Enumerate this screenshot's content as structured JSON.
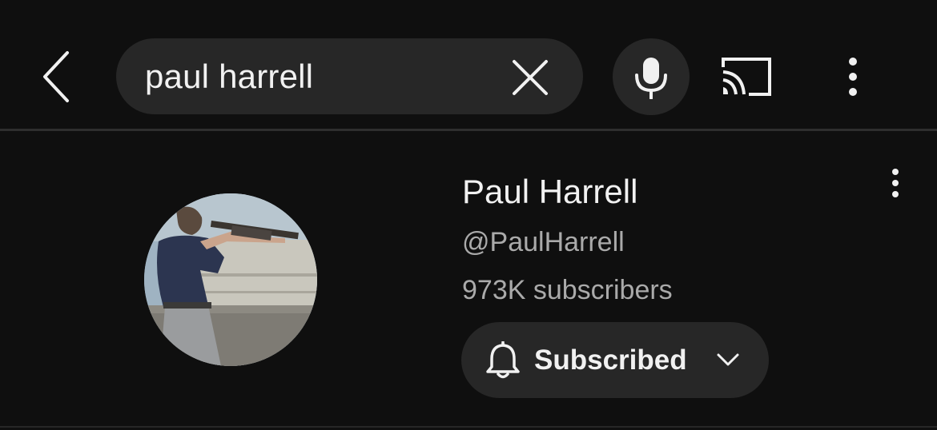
{
  "search": {
    "query": "paul harrell"
  },
  "header": {
    "icons": {
      "back": "back-arrow-icon",
      "clear": "close-icon",
      "mic": "microphone-icon",
      "cast": "cast-icon",
      "more": "more-vertical-icon"
    }
  },
  "channel": {
    "name": "Paul Harrell",
    "handle": "@PaulHarrell",
    "subscribers": "973K subscribers",
    "subscribe_button": {
      "label": "Subscribed",
      "bell_icon": "bell-icon",
      "chevron_icon": "chevron-down-icon"
    },
    "menu_icon": "more-vertical-icon"
  },
  "colors": {
    "background": "#0f0f0f",
    "surface": "#272727",
    "text_primary": "#f1f1f1",
    "text_secondary": "#aaaaaa"
  }
}
